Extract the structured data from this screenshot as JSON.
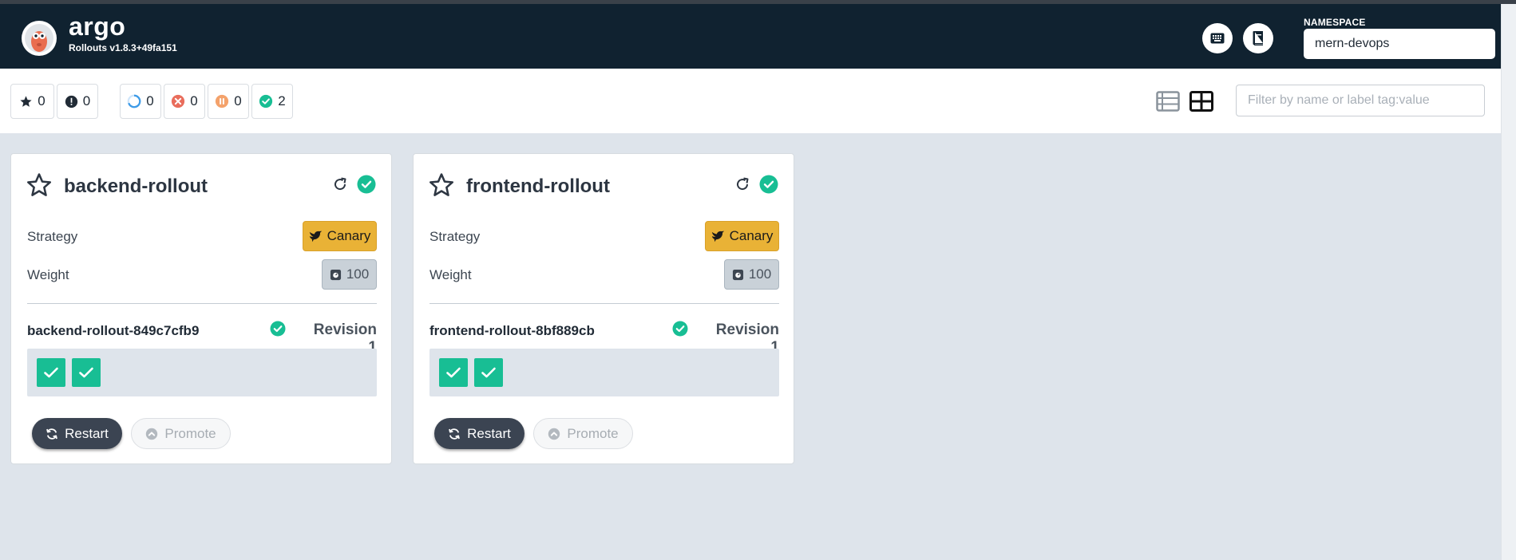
{
  "header": {
    "brand": "argo",
    "version": "Rollouts v1.8.3+49fa151",
    "keyboard_icon": "keyboard-icon",
    "docs_icon": "book-icon",
    "namespace_label": "NAMESPACE",
    "namespace_value": "mern-devops"
  },
  "toolbar": {
    "filters": [
      {
        "icon": "star-icon",
        "count": "0"
      },
      {
        "icon": "exclamation-icon",
        "count": "0"
      },
      {
        "icon": "progressing-icon",
        "count": "0"
      },
      {
        "icon": "degraded-icon",
        "count": "0"
      },
      {
        "icon": "paused-icon",
        "count": "0"
      },
      {
        "icon": "healthy-icon",
        "count": "2"
      }
    ],
    "search_placeholder": "Filter by name or label tag:value"
  },
  "rollouts": [
    {
      "name": "backend-rollout",
      "strategy_label": "Strategy",
      "strategy": "Canary",
      "weight_label": "Weight",
      "weight": "100",
      "replicaset": "backend-rollout-849c7cfb9",
      "revision": "Revision 1",
      "pods": 2,
      "restart_label": "Restart",
      "promote_label": "Promote"
    },
    {
      "name": "frontend-rollout",
      "strategy_label": "Strategy",
      "strategy": "Canary",
      "weight_label": "Weight",
      "weight": "100",
      "replicaset": "frontend-rollout-8bf889cb",
      "revision": "Revision 1",
      "pods": 2,
      "restart_label": "Restart",
      "promote_label": "Promote"
    }
  ],
  "colors": {
    "header_bg": "#102230",
    "healthy": "#18be94",
    "canary": "#e9b236",
    "degraded": "#e96d5c",
    "paused": "#f4a26b",
    "progressing": "#3e9be7"
  }
}
